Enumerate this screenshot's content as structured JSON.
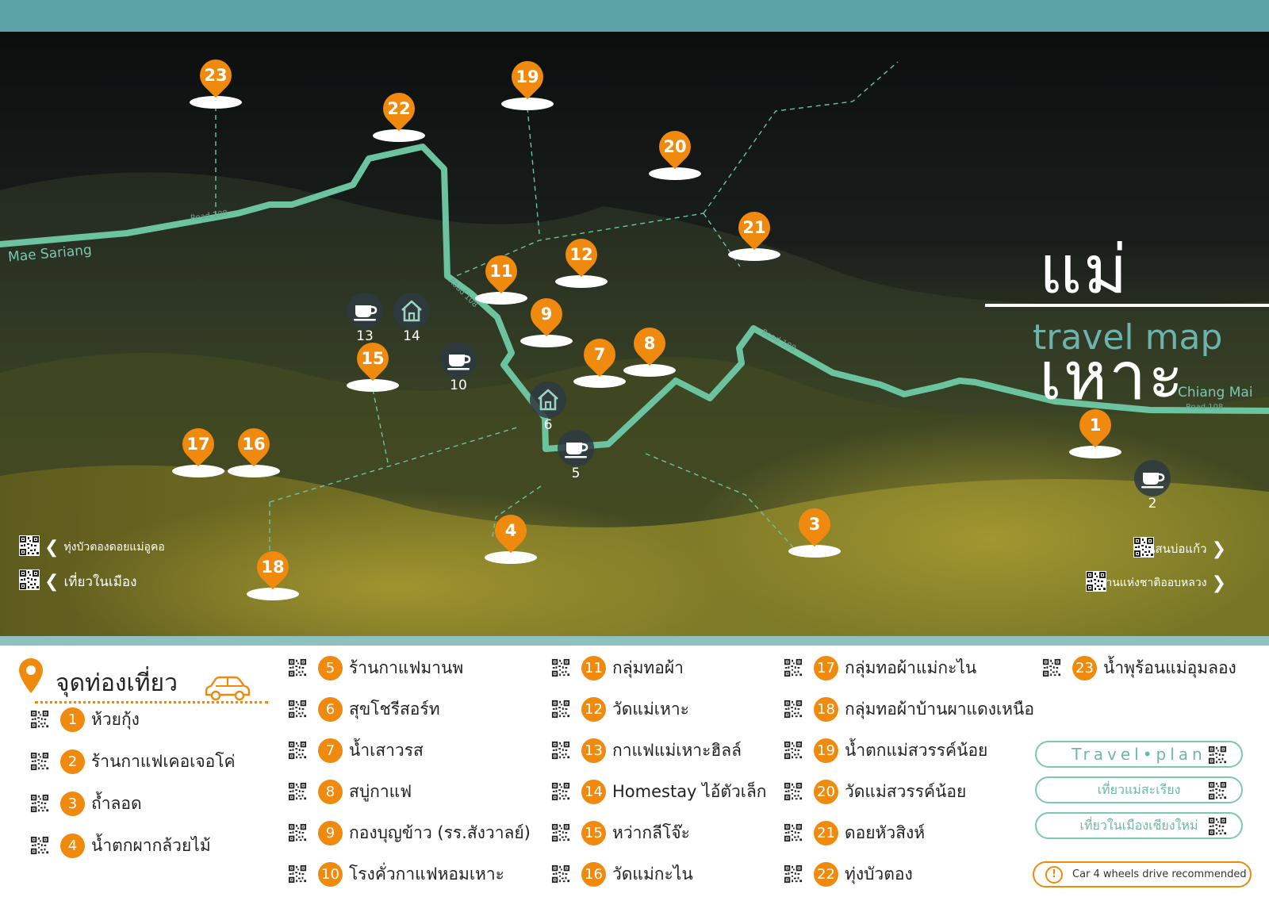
{
  "title": "แม่เหาะ",
  "subtitle": "travel map",
  "map_labels": {
    "mae_sariang": "Mae Sariang",
    "chiang_mai": "Chiang Mai",
    "road": "Road 108"
  },
  "nav_left": [
    "ทุ่งบัวตองดอยแม่อูคอ",
    "เที่ยวในเมือง"
  ],
  "nav_right": [
    "สวนสนบ่อแก้ว",
    "อุทยานแห่งชาติออบหลวง"
  ],
  "map_points": [
    "1",
    "3",
    "4",
    "7",
    "8",
    "9",
    "11",
    "12",
    "15",
    "16",
    "17",
    "18",
    "19",
    "20",
    "21",
    "22",
    "23"
  ],
  "map_icons": [
    {
      "label": "13",
      "type": "cafe-icon"
    },
    {
      "label": "14",
      "type": "home-icon"
    },
    {
      "label": "10",
      "type": "cafe-icon"
    },
    {
      "label": "6",
      "type": "home-icon"
    },
    {
      "label": "5",
      "type": "cafe-icon"
    },
    {
      "label": "2",
      "type": "cafe-icon"
    }
  ],
  "legend_title": "จุดท่องเที่ยว",
  "places": [
    {
      "num": "1",
      "name": "ห้วยกุ้ง"
    },
    {
      "num": "2",
      "name": "ร้านกาแฟเคอเจอโค่"
    },
    {
      "num": "3",
      "name": "ถ้ำลอด"
    },
    {
      "num": "4",
      "name": "น้ำตกผากล้วยไม้"
    },
    {
      "num": "5",
      "name": "ร้านกาแฟมานพ"
    },
    {
      "num": "6",
      "name": "สุขโชรีสอร์ท"
    },
    {
      "num": "7",
      "name": "น้ำเสาวรส"
    },
    {
      "num": "8",
      "name": "สบู่กาแฟ"
    },
    {
      "num": "9",
      "name": "กองบุญข้าว (รร.สังวาลย์)"
    },
    {
      "num": "10",
      "name": "โรงคั่วกาแฟหอมเหาะ"
    },
    {
      "num": "11",
      "name": "กลุ่มทอผ้า"
    },
    {
      "num": "12",
      "name": "วัดแม่เหาะ"
    },
    {
      "num": "13",
      "name": "กาแฟแม่เหาะฮิลล์"
    },
    {
      "num": "14",
      "name": "Homestay ไอ้ตัวเล็ก"
    },
    {
      "num": "15",
      "name": "หว่ากลีโจ๊ะ"
    },
    {
      "num": "16",
      "name": "วัดแม่กะไน"
    },
    {
      "num": "17",
      "name": "กลุ่มทอผ้าแม่กะไน"
    },
    {
      "num": "18",
      "name": "กลุ่มทอผ้าบ้านผาแดงเหนือ"
    },
    {
      "num": "19",
      "name": "น้ำตกแม่สวรรค์น้อย"
    },
    {
      "num": "20",
      "name": "วัดแม่สวรรค์น้อย"
    },
    {
      "num": "21",
      "name": "ดอยหัวสิงห์"
    },
    {
      "num": "22",
      "name": "ทุ่งบัวตอง"
    },
    {
      "num": "23",
      "name": "น้ำพุร้อนแม่อุมลอง"
    }
  ],
  "buttons": [
    "Travel•plan",
    "เที่ยวแม่สะเรียง",
    "เที่ยวในเมืองเชียงใหม่"
  ],
  "car_note": "Car 4 wheels drive recommended",
  "colors": {
    "accent": "#f08a0e",
    "teal": "#5ba3a6",
    "road": "#6cc3a0"
  }
}
